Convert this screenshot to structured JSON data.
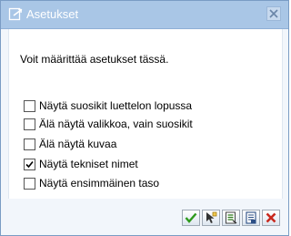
{
  "dialog": {
    "title": "Asetukset",
    "message": "Voit määrittää asetukset tässä.",
    "options": [
      {
        "label": "Näytä suosikit luettelon lopussa",
        "checked": false
      },
      {
        "label": "Älä näytä valikkoa, vain suosikit",
        "checked": false
      },
      {
        "label": "Älä näytä kuvaa",
        "checked": false
      },
      {
        "label": "Näytä tekniset nimet",
        "checked": true
      },
      {
        "label": "Näytä ensimmäinen taso",
        "checked": false
      }
    ]
  },
  "toolbar": {
    "buttons": [
      {
        "icon": "checkmark-icon",
        "color": "#2e9a1c"
      },
      {
        "icon": "cursor-select-icon",
        "color": "#333333"
      },
      {
        "icon": "list-select-icon",
        "color": "#2e7a1c"
      },
      {
        "icon": "document-icon",
        "color": "#2c4f86"
      },
      {
        "icon": "cancel-icon",
        "color": "#c8281e"
      }
    ]
  },
  "colors": {
    "titlebar": "#a9c6e6",
    "background": "#f2f6fb",
    "border": "#7a9cc4"
  }
}
